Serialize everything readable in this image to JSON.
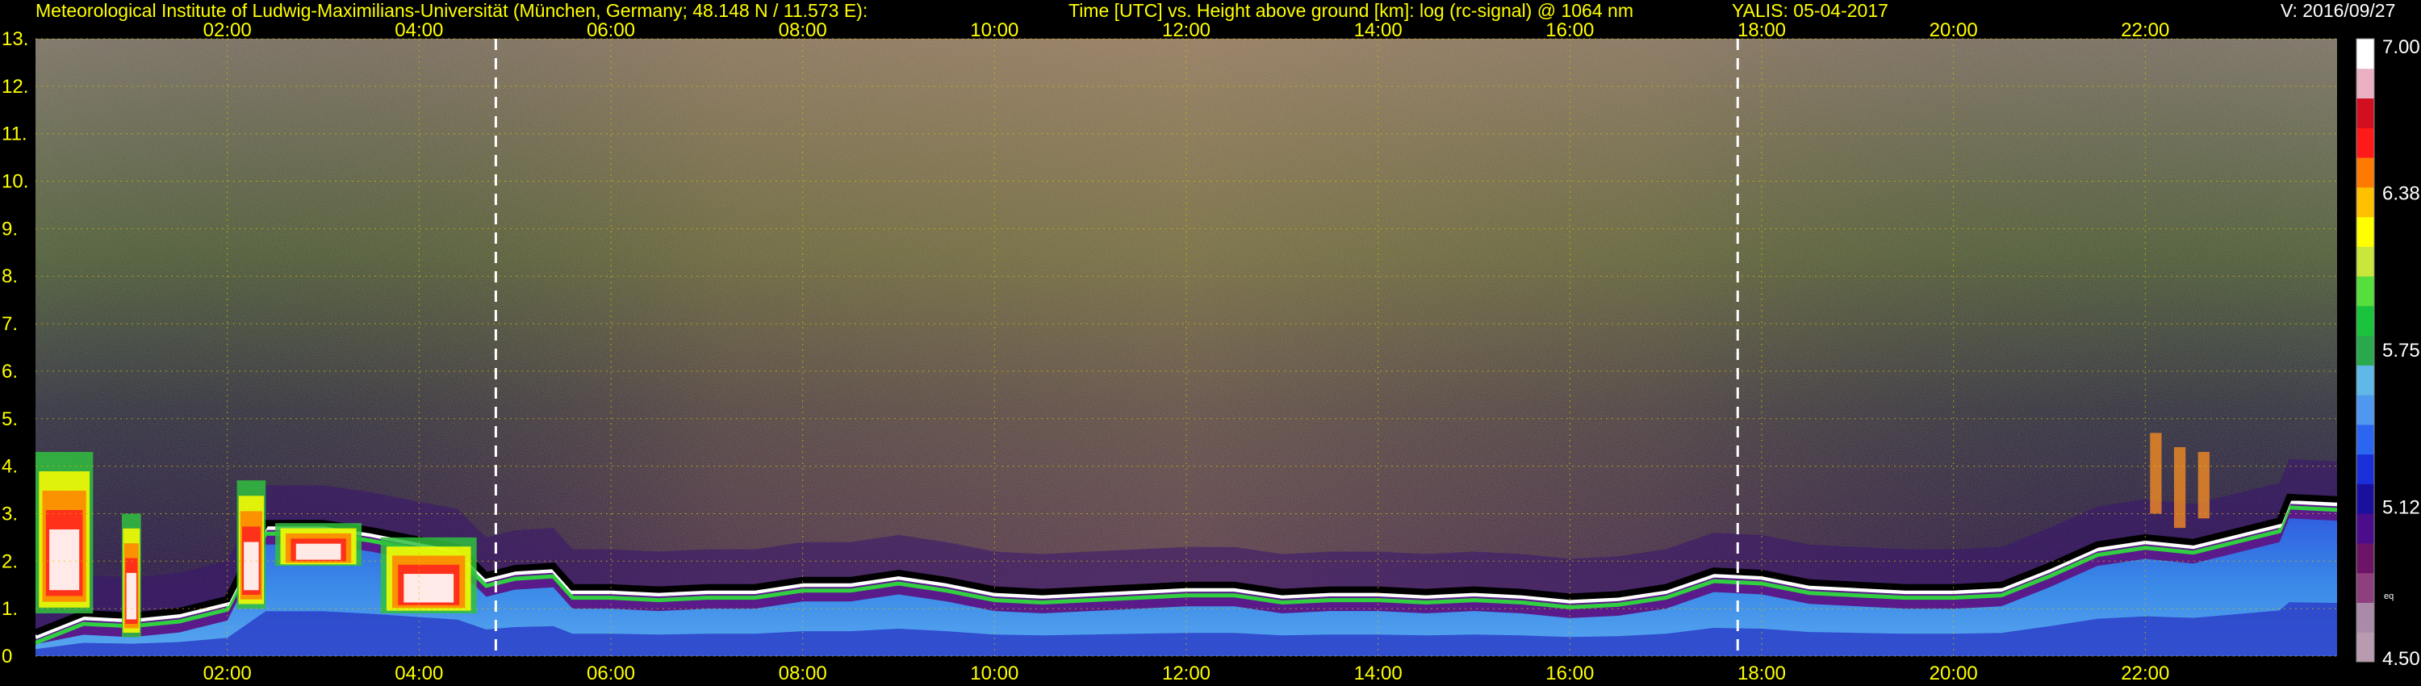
{
  "header": {
    "institute": "Meteorological Institute of Ludwig-Maximilians-Universität (München, Germany; 48.148 N / 11.573 E):",
    "description": "Time [UTC] vs. Height above ground [km]: log (rc-signal) @ 1064 nm",
    "instrument_date": "YALIS: 05-04-2017",
    "version": "V: 2016/09/27"
  },
  "chart_data": {
    "type": "heatmap",
    "title": "Time [UTC] vs. Height above ground [km]: log (rc-signal) @ 1064 nm",
    "x": {
      "range": [
        0,
        24
      ],
      "tick_values": [
        2,
        4,
        6,
        8,
        10,
        12,
        14,
        16,
        18,
        20,
        22
      ],
      "tick_labels": [
        "02:00",
        "04:00",
        "06:00",
        "08:00",
        "10:00",
        "12:00",
        "14:00",
        "16:00",
        "18:00",
        "20:00",
        "22:00"
      ]
    },
    "y": {
      "range": [
        0,
        13
      ],
      "tick_values": [
        0,
        1,
        2,
        3,
        4,
        5,
        6,
        7,
        8,
        9,
        10,
        11,
        12,
        13
      ],
      "tick_labels": [
        "0",
        "1.",
        "2.",
        "3.",
        "4.",
        "5.",
        "6.",
        "7.",
        "8.",
        "9.",
        "10.",
        "11.",
        "12.",
        "13."
      ]
    },
    "grid": true,
    "colorbar": {
      "range": [
        4.5,
        7.0
      ],
      "tick_values": [
        7.0,
        6.38,
        5.75,
        5.12,
        4.5
      ],
      "tick_labels": [
        "7.00",
        "6.38",
        "5.75",
        "5.12",
        "4.50"
      ],
      "small_label": "eq",
      "colors": [
        "#b99bb0",
        "#a98aa8",
        "#8e3f7e",
        "#6e1466",
        "#4b0d8c",
        "#1b0f9e",
        "#1a2fd8",
        "#2b66f0",
        "#4f98f0",
        "#5fb8e8",
        "#2aa84e",
        "#19c43c",
        "#56de3c",
        "#c8e63b",
        "#ffff00",
        "#ffc000",
        "#ff7a00",
        "#ff1a1a",
        "#d01020",
        "#e8b0c0",
        "#ffffff"
      ]
    },
    "markers": {
      "dashed_verticals": [
        4.8,
        17.75
      ]
    },
    "boundary_layer_top_km": [
      [
        0.0,
        0.4
      ],
      [
        0.5,
        0.8
      ],
      [
        1.0,
        0.75
      ],
      [
        1.5,
        0.85
      ],
      [
        2.0,
        1.1
      ],
      [
        2.4,
        2.7
      ],
      [
        3.0,
        2.7
      ],
      [
        3.5,
        2.55
      ],
      [
        4.0,
        2.35
      ],
      [
        4.4,
        2.2
      ],
      [
        4.7,
        1.6
      ],
      [
        5.0,
        1.75
      ],
      [
        5.4,
        1.8
      ],
      [
        5.6,
        1.35
      ],
      [
        6.0,
        1.35
      ],
      [
        6.5,
        1.3
      ],
      [
        7.0,
        1.35
      ],
      [
        7.5,
        1.35
      ],
      [
        8.0,
        1.5
      ],
      [
        8.5,
        1.5
      ],
      [
        9.0,
        1.65
      ],
      [
        9.5,
        1.5
      ],
      [
        10.0,
        1.3
      ],
      [
        10.5,
        1.25
      ],
      [
        11.0,
        1.3
      ],
      [
        11.5,
        1.35
      ],
      [
        12.0,
        1.4
      ],
      [
        12.5,
        1.4
      ],
      [
        13.0,
        1.25
      ],
      [
        13.5,
        1.3
      ],
      [
        14.0,
        1.3
      ],
      [
        14.5,
        1.25
      ],
      [
        15.0,
        1.3
      ],
      [
        15.5,
        1.25
      ],
      [
        16.0,
        1.15
      ],
      [
        16.5,
        1.2
      ],
      [
        17.0,
        1.35
      ],
      [
        17.5,
        1.7
      ],
      [
        18.0,
        1.65
      ],
      [
        18.5,
        1.45
      ],
      [
        19.0,
        1.4
      ],
      [
        19.5,
        1.35
      ],
      [
        20.0,
        1.35
      ],
      [
        20.5,
        1.4
      ],
      [
        21.0,
        1.8
      ],
      [
        21.5,
        2.25
      ],
      [
        22.0,
        2.4
      ],
      [
        22.5,
        2.3
      ],
      [
        23.0,
        2.55
      ],
      [
        23.4,
        2.75
      ],
      [
        23.5,
        3.25
      ],
      [
        24.0,
        3.2
      ]
    ]
  }
}
